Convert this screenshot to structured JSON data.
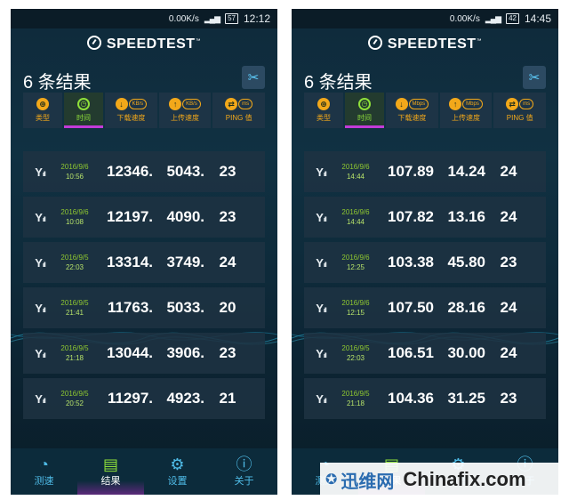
{
  "screens": [
    {
      "status": {
        "network_speed": "0.00K/s",
        "battery": "57",
        "time": "12:12"
      },
      "brand": {
        "name": "SPEEDTEST",
        "mark": "™"
      },
      "results_count": "6 条结果",
      "sort_tabs": [
        {
          "label": "类型",
          "pill": ""
        },
        {
          "label": "时间",
          "pill": ""
        },
        {
          "label": "下载速度",
          "pill": "KB/s"
        },
        {
          "label": "上传速度",
          "pill": "KB/s"
        },
        {
          "label": "PING 值",
          "pill": "ms"
        }
      ],
      "rows": [
        {
          "date": "2016/9/6",
          "time": "10:56",
          "download": "12346.",
          "upload": "5043.",
          "ping": "23"
        },
        {
          "date": "2016/9/6",
          "time": "10:08",
          "download": "12197.",
          "upload": "4090.",
          "ping": "23"
        },
        {
          "date": "2016/9/5",
          "time": "22:03",
          "download": "13314.",
          "upload": "3749.",
          "ping": "24"
        },
        {
          "date": "2016/9/5",
          "time": "21:41",
          "download": "11763.",
          "upload": "5033.",
          "ping": "20"
        },
        {
          "date": "2016/9/5",
          "time": "21:18",
          "download": "13044.",
          "upload": "3906.",
          "ping": "23"
        },
        {
          "date": "2016/9/5",
          "time": "20:52",
          "download": "11297.",
          "upload": "4923.",
          "ping": "21"
        }
      ],
      "nav": [
        {
          "label": "测速",
          "icon": "gauge-icon"
        },
        {
          "label": "结果",
          "icon": "results-icon"
        },
        {
          "label": "设置",
          "icon": "gear-icon"
        },
        {
          "label": "关于",
          "icon": "info-icon"
        }
      ]
    },
    {
      "status": {
        "network_speed": "0.00K/s",
        "battery": "42",
        "time": "14:45"
      },
      "brand": {
        "name": "SPEEDTEST",
        "mark": "™"
      },
      "results_count": "6 条结果",
      "sort_tabs": [
        {
          "label": "类型",
          "pill": ""
        },
        {
          "label": "时间",
          "pill": ""
        },
        {
          "label": "下载速度",
          "pill": "Mbps"
        },
        {
          "label": "上传速度",
          "pill": "Mbps"
        },
        {
          "label": "PING 值",
          "pill": "ms"
        }
      ],
      "rows": [
        {
          "date": "2016/9/6",
          "time": "14:44",
          "download": "107.89",
          "upload": "14.24",
          "ping": "24"
        },
        {
          "date": "2016/9/6",
          "time": "14:44",
          "download": "107.82",
          "upload": "13.16",
          "ping": "24"
        },
        {
          "date": "2016/9/6",
          "time": "12:25",
          "download": "103.38",
          "upload": "45.80",
          "ping": "23"
        },
        {
          "date": "2016/9/6",
          "time": "12:15",
          "download": "107.50",
          "upload": "28.16",
          "ping": "24"
        },
        {
          "date": "2016/9/5",
          "time": "22:03",
          "download": "106.51",
          "upload": "30.00",
          "ping": "24"
        },
        {
          "date": "2016/9/5",
          "time": "21:18",
          "download": "104.36",
          "upload": "31.25",
          "ping": "23"
        }
      ],
      "nav": [
        {
          "label": "测速",
          "icon": "gauge-icon"
        },
        {
          "label": "结果",
          "icon": "results-icon"
        },
        {
          "label": "设置",
          "icon": "gear-icon"
        },
        {
          "label": "关于",
          "icon": "info-icon"
        }
      ]
    }
  ],
  "watermark": {
    "site1": "迅维网",
    "site2": "Chinafix.com"
  },
  "colors": {
    "accent_green": "#8fe03a",
    "accent_orange": "#f2a81a",
    "accent_blue": "#4fbce8",
    "active_purple": "#c33bd8"
  }
}
